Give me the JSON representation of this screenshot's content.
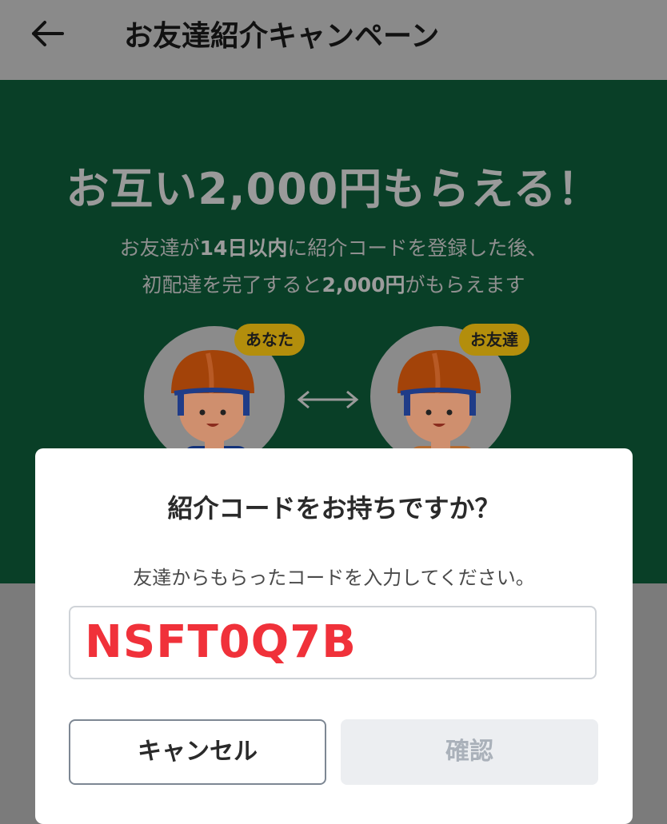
{
  "header": {
    "title": "お友達紹介キャンペーン"
  },
  "hero": {
    "title": "お互い2,000円もらえる！",
    "desc_line1_a": "お友達が",
    "desc_line1_b": "14日以内",
    "desc_line1_c": "に紹介コードを登録した後、",
    "desc_line2_a": "初配達を完了すると",
    "desc_line2_b": "2,000円",
    "desc_line2_c": "がもらえます",
    "badge_you": "あなた",
    "badge_friend": "お友達"
  },
  "dialog": {
    "title": "紹介コードをお持ちですか？",
    "subtitle": "友達からもらったコードを入力してください。",
    "code_value": "NSFT0Q7B",
    "cancel_label": "キャンセル",
    "confirm_label": "確認"
  },
  "colors": {
    "overlay": "#7b7b7b",
    "hero_green": "#093f27",
    "code_red": "#f0313a",
    "badge_yellow": "#b38e0c"
  },
  "icons": [
    "back-arrow-icon",
    "exchange-arrow-icon",
    "courier-avatar-icon"
  ]
}
